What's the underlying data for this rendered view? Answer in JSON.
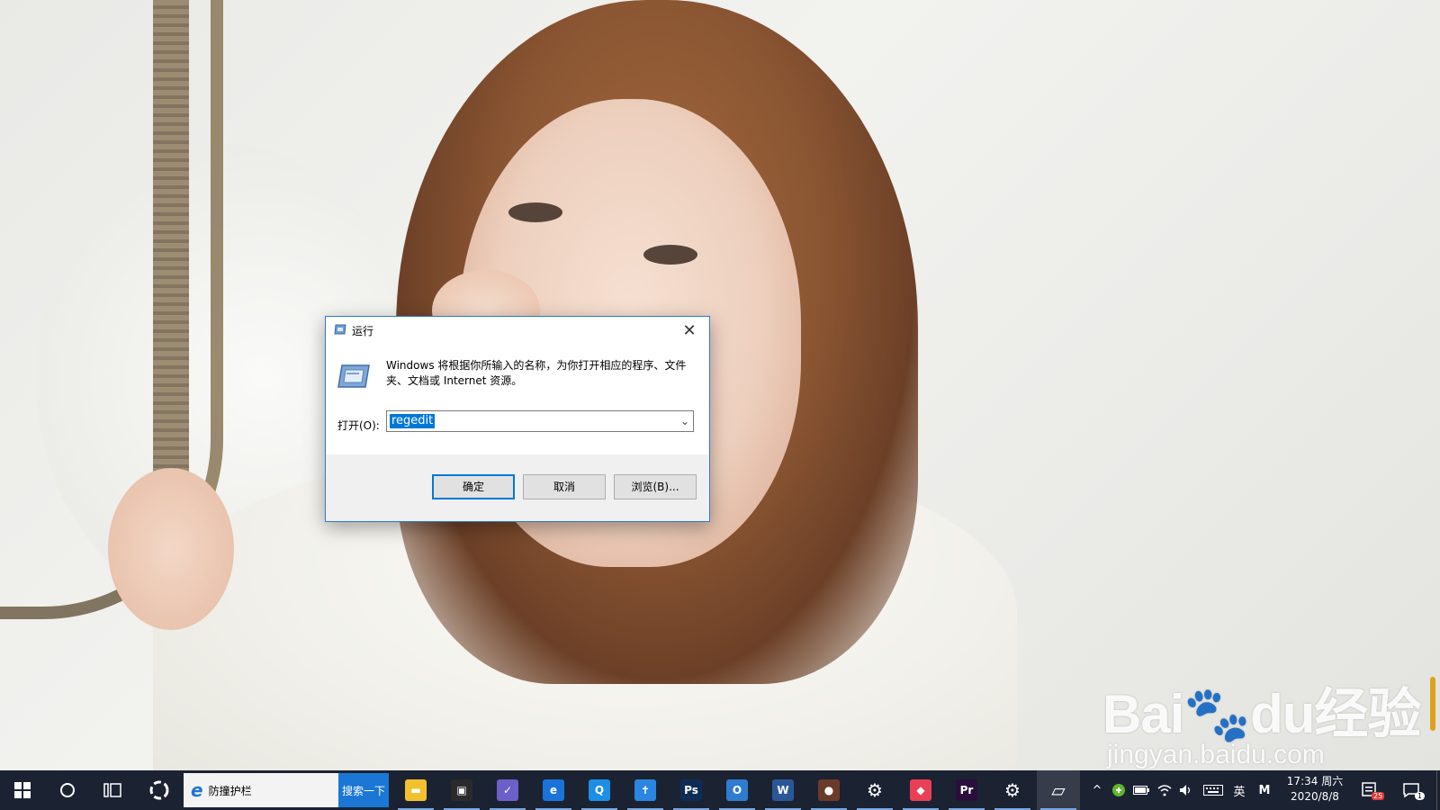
{
  "dialog": {
    "title": "运行",
    "description": "Windows 将根据你所输入的名称，为你打开相应的程序、文件夹、文档或 Internet 资源。",
    "open_label": "打开(O):",
    "open_value": "regedit",
    "ok_label": "确定",
    "cancel_label": "取消",
    "browse_label": "浏览(B)...",
    "close_symbol": "✕"
  },
  "taskbar": {
    "search_text": "防撞护栏",
    "search_button": "搜索一下",
    "apps": [
      {
        "name": "file-explorer",
        "glyph": "▬",
        "color": "#f2c12e"
      },
      {
        "name": "store",
        "glyph": "▣",
        "color": "#2b2b2b"
      },
      {
        "name": "app-purple",
        "glyph": "✓",
        "color": "#6c5fc7"
      },
      {
        "name": "edge",
        "glyph": "e",
        "color": "#1a73d9"
      },
      {
        "name": "browser-q",
        "glyph": "Q",
        "color": "#1d8ee6"
      },
      {
        "name": "app-blue-t",
        "glyph": "✝",
        "color": "#2a86e0"
      },
      {
        "name": "photoshop",
        "glyph": "Ps",
        "color": "#0f2c57"
      },
      {
        "name": "outlook",
        "glyph": "O",
        "color": "#2f7bd0"
      },
      {
        "name": "word",
        "glyph": "W",
        "color": "#2b5797"
      },
      {
        "name": "game",
        "glyph": "●",
        "color": "#6b3b2a"
      },
      {
        "name": "settings",
        "glyph": "⚙",
        "color": "transparent"
      },
      {
        "name": "app-colorful",
        "glyph": "◆",
        "color": "#e94057"
      },
      {
        "name": "premiere",
        "glyph": "Pr",
        "color": "#2a0f3c"
      },
      {
        "name": "control-settings",
        "glyph": "⚙",
        "color": "transparent"
      },
      {
        "name": "run-app",
        "glyph": "▱",
        "color": "transparent"
      }
    ],
    "tray": {
      "ime": "英",
      "m_label": "M",
      "time": "17:34 周六",
      "date": "2020/8/8",
      "notification_badge": "25",
      "action_center_badge": "1"
    }
  },
  "watermark": {
    "logo": "Bai🐾du经验",
    "url": "jingyan.baidu.com"
  },
  "colors": {
    "taskbar_bg": "#1b2232",
    "accent": "#0078d7",
    "search_button": "#1a77d6"
  }
}
